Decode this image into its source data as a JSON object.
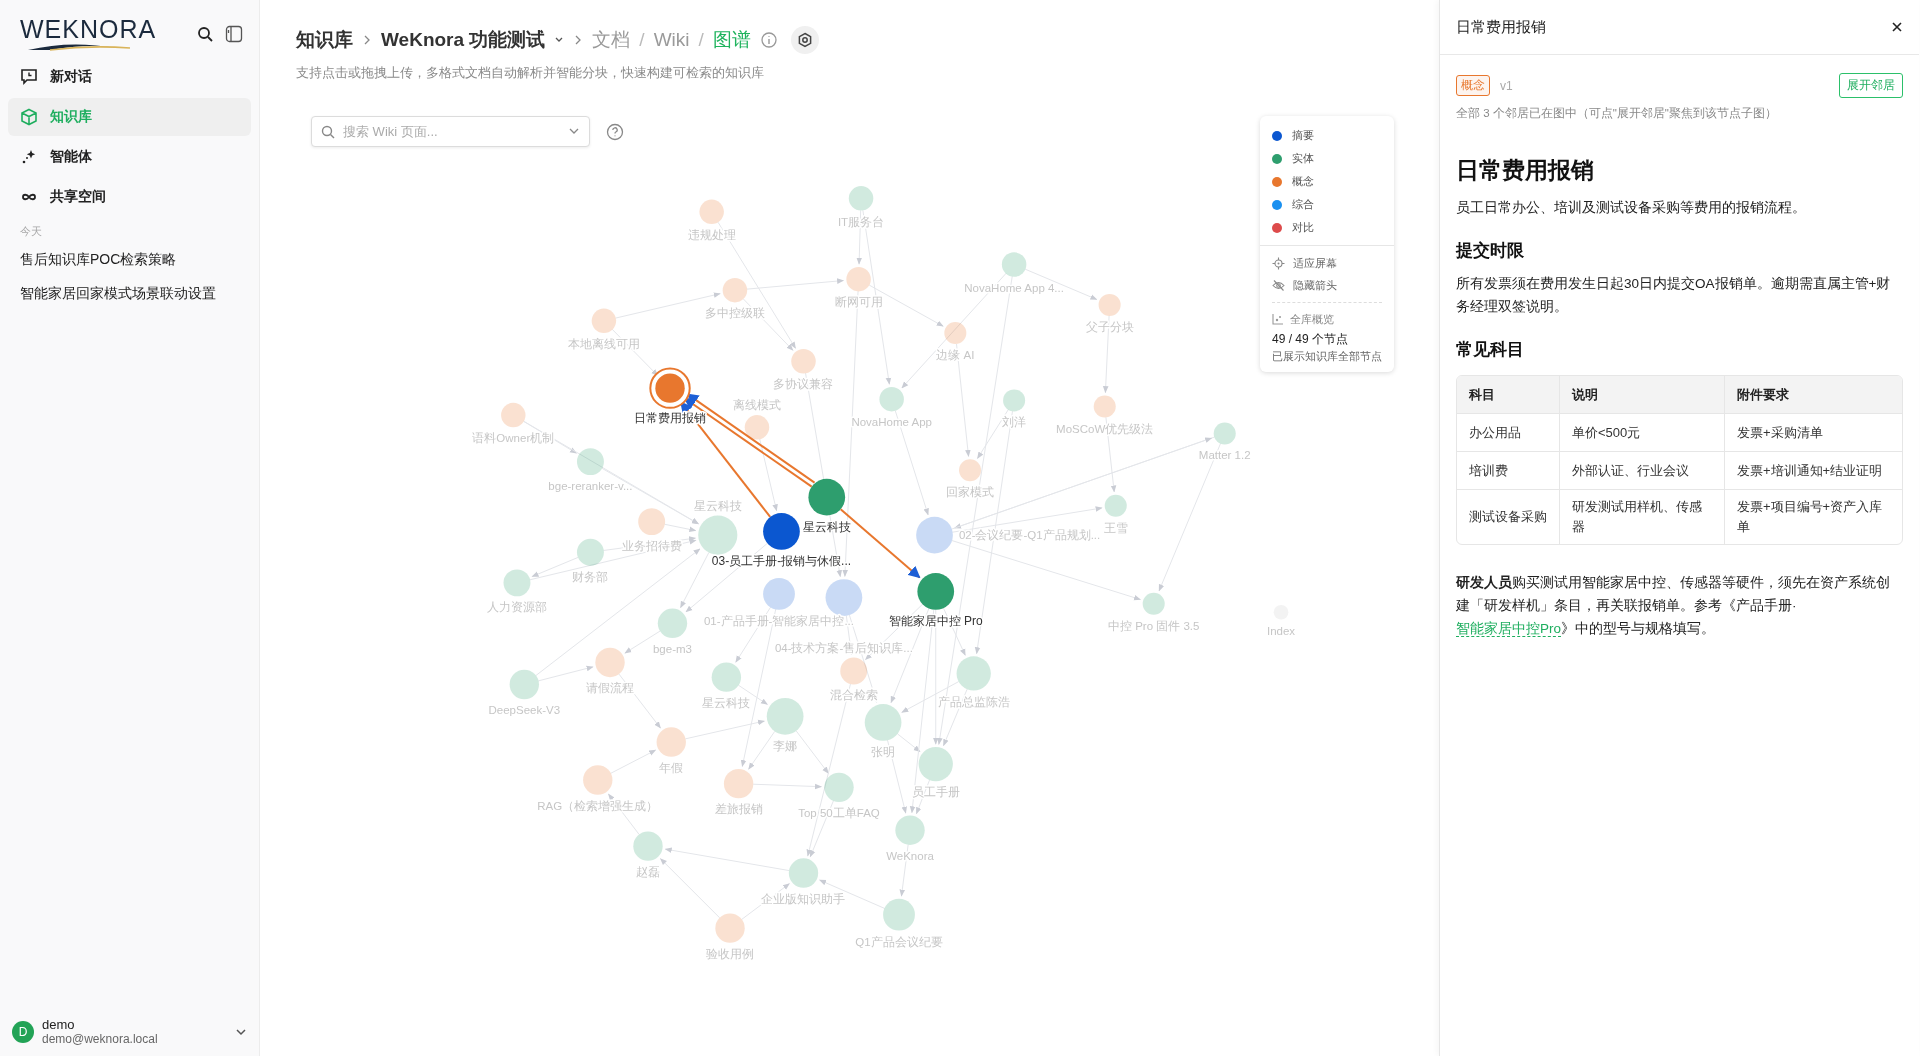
{
  "sidebar": {
    "logo": "WEKNORA",
    "nav": [
      {
        "label": "新对话",
        "kind": "chat",
        "selected": false
      },
      {
        "label": "知识库",
        "kind": "knowledge",
        "selected": true
      },
      {
        "label": "智能体",
        "kind": "agent",
        "selected": false
      },
      {
        "label": "共享空间",
        "kind": "space",
        "selected": false
      }
    ],
    "section_title": "今天",
    "chats": [
      "售后知识库POC检索策略",
      "智能家居回家模式场景联动设置"
    ],
    "user": {
      "avatar": "D",
      "name": "demo",
      "email": "demo@weknora.local"
    }
  },
  "header": {
    "breadcrumb": [
      "知识库",
      "WeKnora 功能测试"
    ],
    "view_separator": "/",
    "views": [
      {
        "label": "文档",
        "selected": false
      },
      {
        "label": "Wiki",
        "selected": false
      },
      {
        "label": "图谱",
        "selected": true
      }
    ],
    "subtitle": "支持点击或拖拽上传，多格式文档自动解析并智能分块，快速构建可检索的知识库"
  },
  "graph": {
    "search": {
      "placeholder": "搜索 Wiki 页面..."
    },
    "legend": [
      {
        "label": "摘要",
        "kind": "summary",
        "color": "#0b57d0"
      },
      {
        "label": "实体",
        "kind": "entity",
        "color": "#2e9e6e"
      },
      {
        "label": "概念",
        "kind": "concept",
        "color": "#e8772e"
      },
      {
        "label": "综合",
        "kind": "synthesis",
        "color": "#1a90f0"
      },
      {
        "label": "对比",
        "kind": "comparison",
        "color": "#dd4b4b"
      }
    ],
    "actions": [
      {
        "label": "适应屏幕",
        "kind": "fit"
      },
      {
        "label": "隐藏箭头",
        "kind": "arrows"
      }
    ],
    "overview": {
      "title": "全库概览",
      "count": "49 / 49 个节点",
      "note": "已展示知识库全部节点"
    },
    "nodes": [
      {
        "label": "违规处理",
        "kind": "concept",
        "dimmed": true,
        "selected": false
      },
      {
        "label": "IT服务台",
        "kind": "entity",
        "dimmed": true,
        "selected": false
      },
      {
        "label": "多中控级联",
        "kind": "concept",
        "dimmed": true,
        "selected": false
      },
      {
        "label": "断网可用",
        "kind": "concept",
        "dimmed": true,
        "selected": false
      },
      {
        "label": "NovaHome App 4...",
        "kind": "entity",
        "dimmed": true,
        "selected": false
      },
      {
        "label": "父子分块",
        "kind": "concept",
        "dimmed": true,
        "selected": false
      },
      {
        "label": "本地离线可用",
        "kind": "concept",
        "dimmed": true,
        "selected": false
      },
      {
        "label": "边缘 AI",
        "kind": "concept",
        "dimmed": true,
        "selected": false
      },
      {
        "label": "多协议兼容",
        "kind": "concept",
        "dimmed": true,
        "selected": false
      },
      {
        "label": "日常费用报销",
        "kind": "concept",
        "dimmed": false,
        "selected": true
      },
      {
        "label": "语料Owner机制",
        "kind": "concept",
        "dimmed": true,
        "selected": false
      },
      {
        "label": "NovaHome App",
        "kind": "entity",
        "dimmed": true,
        "selected": false
      },
      {
        "label": "刘洋",
        "kind": "entity",
        "dimmed": true,
        "selected": false
      },
      {
        "label": "MoSCoW优先级法",
        "kind": "concept",
        "dimmed": true,
        "selected": false
      },
      {
        "label": "Matter 1.2",
        "kind": "entity",
        "dimmed": true,
        "selected": false
      },
      {
        "label": "离线模式",
        "kind": "concept",
        "dimmed": true,
        "selected": false
      },
      {
        "label": "bge-reranker-v...",
        "kind": "entity",
        "dimmed": true,
        "selected": false
      },
      {
        "label": "回家模式",
        "kind": "concept",
        "dimmed": true,
        "selected": false
      },
      {
        "label": "王雪",
        "kind": "entity",
        "dimmed": true,
        "selected": false
      },
      {
        "label": "业务招待费",
        "kind": "concept",
        "dimmed": true,
        "selected": false
      },
      {
        "label": "星云科技",
        "kind": "entity",
        "dimmed": true,
        "selected": false
      },
      {
        "label": "星云科技",
        "kind": "entity",
        "dimmed": false,
        "selected": false
      },
      {
        "label": "03-员工手册-报销与休假...",
        "kind": "summary",
        "dimmed": false,
        "selected": false
      },
      {
        "label": "02-会议纪要-Q1产品规划...",
        "kind": "summary",
        "dimmed": true,
        "selected": false
      },
      {
        "label": "财务部",
        "kind": "entity",
        "dimmed": true,
        "selected": false
      },
      {
        "label": "人力资源部",
        "kind": "entity",
        "dimmed": true,
        "selected": false
      },
      {
        "label": "智能家居中控 Pro",
        "kind": "entity",
        "dimmed": false,
        "selected": false
      },
      {
        "label": "中控 Pro 固件 3.5",
        "kind": "entity",
        "dimmed": true,
        "selected": false
      },
      {
        "label": "Index",
        "kind": "index",
        "dimmed": true,
        "selected": false
      },
      {
        "label": "01-产品手册-智能家居中控...",
        "kind": "summary",
        "dimmed": true,
        "selected": false
      },
      {
        "label": "bge-m3",
        "kind": "entity",
        "dimmed": true,
        "selected": false
      },
      {
        "label": "04-技术方案-售后知识库...",
        "kind": "summary",
        "dimmed": true,
        "selected": false
      },
      {
        "label": "请假流程",
        "kind": "concept",
        "dimmed": true,
        "selected": false
      },
      {
        "label": "混合检索",
        "kind": "concept",
        "dimmed": true,
        "selected": false
      },
      {
        "label": "DeepSeek-V3",
        "kind": "entity",
        "dimmed": true,
        "selected": false
      },
      {
        "label": "星云科技",
        "kind": "entity",
        "dimmed": true,
        "selected": false
      },
      {
        "label": "产品总监陈浩",
        "kind": "entity",
        "dimmed": true,
        "selected": false
      },
      {
        "label": "李娜",
        "kind": "entity",
        "dimmed": true,
        "selected": false
      },
      {
        "label": "张明",
        "kind": "entity",
        "dimmed": true,
        "selected": false
      },
      {
        "label": "年假",
        "kind": "concept",
        "dimmed": true,
        "selected": false
      },
      {
        "label": "员工手册",
        "kind": "entity",
        "dimmed": true,
        "selected": false
      },
      {
        "label": "RAG（检索增强生成）",
        "kind": "concept",
        "dimmed": true,
        "selected": false
      },
      {
        "label": "差旅报销",
        "kind": "concept",
        "dimmed": true,
        "selected": false
      },
      {
        "label": "Top 50工单FAQ",
        "kind": "entity",
        "dimmed": true,
        "selected": false
      },
      {
        "label": "WeKnora",
        "kind": "entity",
        "dimmed": true,
        "selected": false
      },
      {
        "label": "赵磊",
        "kind": "entity",
        "dimmed": true,
        "selected": false
      },
      {
        "label": "企业版知识助手",
        "kind": "entity",
        "dimmed": true,
        "selected": false
      },
      {
        "label": "验收用例",
        "kind": "concept",
        "dimmed": true,
        "selected": false
      },
      {
        "label": "Q1产品会议纪要",
        "kind": "entity",
        "dimmed": true,
        "selected": false
      }
    ]
  },
  "panel": {
    "title": "日常费用报销",
    "tag": {
      "label": "概念",
      "kind": "concept"
    },
    "version": "v1",
    "expand_button": "展开邻居",
    "note": "全部 3 个邻居已在图中（可点\"展开邻居\"聚焦到该节点子图）",
    "article": {
      "title": "日常费用报销",
      "intro": "员工日常办公、培训及测试设备采购等费用的报销流程。",
      "sections": [
        {
          "heading": "提交时限",
          "text": "所有发票须在费用发生日起30日内提交OA报销单。逾期需直属主管+财务经理双签说明。"
        },
        {
          "heading": "常见科目",
          "table": {
            "columns": [
              "科目",
              "说明",
              "附件要求"
            ],
            "rows": [
              [
                "办公用品",
                "单价<500元",
                "发票+采购清单"
              ],
              [
                "培训费",
                "外部认证、行业会议",
                "发票+培训通知+结业证明"
              ],
              [
                "测试设备采购",
                "研发测试用样机、传感器",
                "发票+项目编号+资产入库单"
              ]
            ]
          }
        }
      ],
      "footer": {
        "text_before": "**研发人员**购买测试用智能家居中控、传感器等硬件，须先在资产系统创建「研发样机」条目，再关联报销单。参考《产品手册·",
        "link": "智能家居中控Pro",
        "text_after": "》中的型号与规格填写。"
      }
    }
  }
}
